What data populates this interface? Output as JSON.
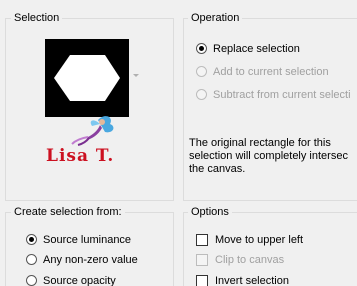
{
  "selection": {
    "title": "Selection"
  },
  "operation": {
    "title": "Operation",
    "options": [
      {
        "label": "Replace selection",
        "checked": true,
        "disabled": false
      },
      {
        "label": "Add to current selection",
        "checked": false,
        "disabled": true
      },
      {
        "label": "Subtract from current selecti",
        "checked": false,
        "disabled": true
      }
    ],
    "info_lines": [
      "The original rectangle for this",
      "selection will completely intersec",
      "the canvas."
    ]
  },
  "create_from": {
    "title": "Create selection from:",
    "options": [
      {
        "label": "Source luminance",
        "checked": true
      },
      {
        "label": "Any non-zero value",
        "checked": false
      },
      {
        "label": "Source opacity",
        "checked": false
      }
    ]
  },
  "options_group": {
    "title": "Options",
    "items": [
      {
        "label": "Move to upper left",
        "checked": false,
        "disabled": false
      },
      {
        "label": "Clip to canvas",
        "checked": false,
        "disabled": true
      },
      {
        "label": "Invert selection",
        "checked": false,
        "disabled": false
      }
    ]
  },
  "watermark": {
    "text": "Lisa T."
  },
  "colors": {
    "watermark_red": "#cc1020",
    "panel_bg": "#f0f0f0",
    "group_border": "#dcdcdc"
  }
}
